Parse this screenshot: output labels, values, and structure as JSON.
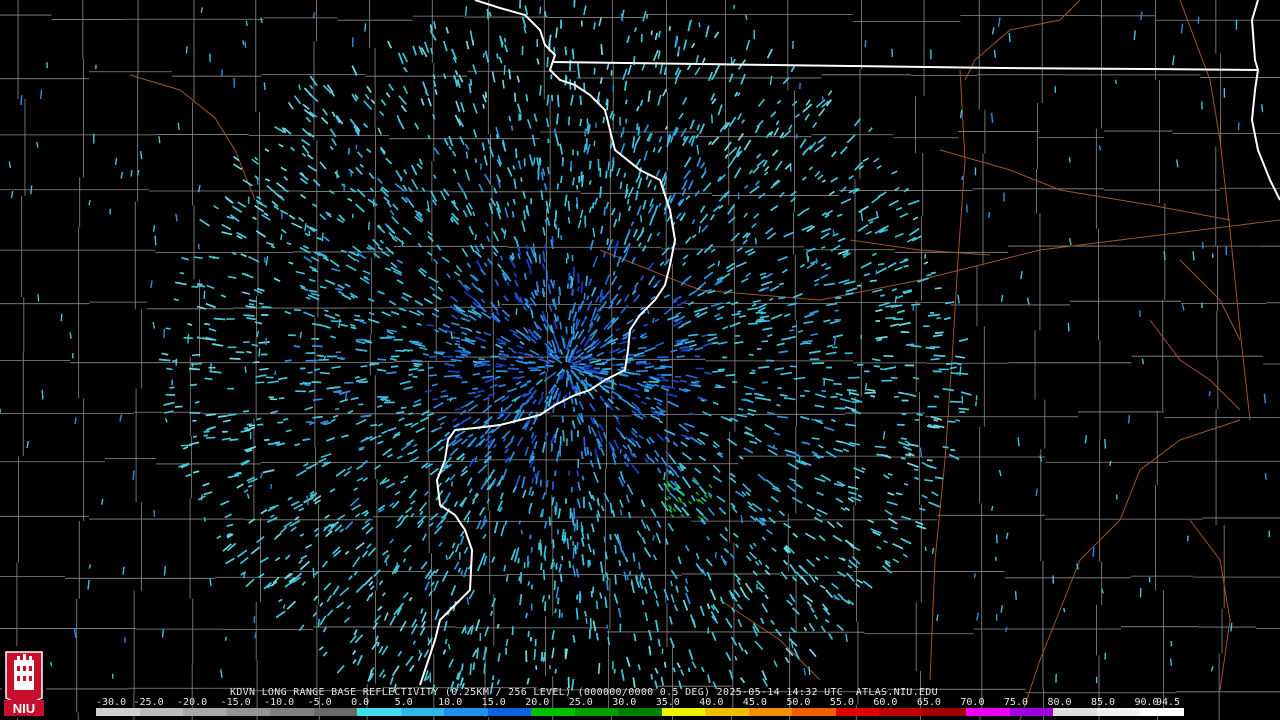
{
  "caption": {
    "product_text": "KDVN LONG RANGE BASE REFLECTIVITY (0.25KM / 256 LEVEL) (000000/0000 0.5 DEG) 2025-05-14 14:32 UTC  ATLAS.NIU.EDU"
  },
  "logo": {
    "text": "NIU"
  },
  "scale": {
    "labels": [
      "-30.0",
      "-25.0",
      "-20.0",
      "-15.0",
      "-10.0",
      "-5.0",
      "0.0",
      "5.0",
      "10.0",
      "15.0",
      "20.0",
      "25.0",
      "30.0",
      "35.0",
      "40.0",
      "45.0",
      "50.0",
      "55.0",
      "60.0",
      "65.0",
      "70.0",
      "75.0",
      "80.0",
      "85.0",
      "90.0",
      "94.5"
    ],
    "colors": [
      "#cfcfcf",
      "#bcbcbc",
      "#a8a8a8",
      "#949494",
      "#808080",
      "#6a6a6a",
      "#40e0e8",
      "#30b8e8",
      "#2090e8",
      "#1060e0",
      "#00c000",
      "#00a000",
      "#008000",
      "#f0f000",
      "#f0c000",
      "#f09000",
      "#f06000",
      "#e00000",
      "#c00000",
      "#a00000",
      "#f000f0",
      "#a000e0",
      "#e0e0e0",
      "#f0f0f0",
      "#ffffff"
    ]
  },
  "map": {
    "state_border_color": "#ffffff",
    "county_line_color": "#8c8c8c",
    "highway_color": "#a0522d",
    "echo_colors": [
      "#3fc6d8",
      "#36b8e0",
      "#2a8fe0",
      "#1f5fd8",
      "#6fd8e0",
      "#1a3fc8"
    ],
    "radar_site": "KDVN"
  }
}
